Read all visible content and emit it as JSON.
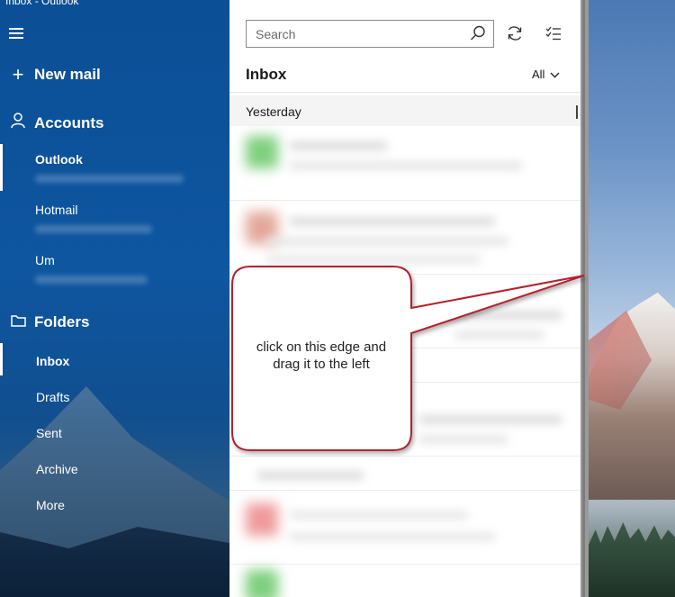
{
  "window": {
    "title": "Inbox - Outlook"
  },
  "sidebar": {
    "new_mail": {
      "label": "New mail",
      "icon": "plus-icon"
    },
    "accounts": {
      "label": "Accounts",
      "icon": "person-icon",
      "items": [
        {
          "name": "Outlook",
          "selected": true
        },
        {
          "name": "Hotmail",
          "selected": false
        },
        {
          "name": "Um",
          "selected": false
        }
      ]
    },
    "folders": {
      "label": "Folders",
      "icon": "folder-icon",
      "items": [
        {
          "name": "Inbox",
          "selected": true
        },
        {
          "name": "Drafts",
          "selected": false
        },
        {
          "name": "Sent",
          "selected": false
        },
        {
          "name": "Archive",
          "selected": false
        },
        {
          "name": "More",
          "selected": false
        }
      ]
    }
  },
  "mail_list": {
    "search_placeholder": "Search",
    "title": "Inbox",
    "filter": "All",
    "group_header": "Yesterday"
  },
  "annotation": {
    "line1": "click on this edge and",
    "line2": "drag it to the left"
  },
  "colors": {
    "sidebar_blue": "#0e56a0",
    "callout_border": "#b3222f"
  }
}
